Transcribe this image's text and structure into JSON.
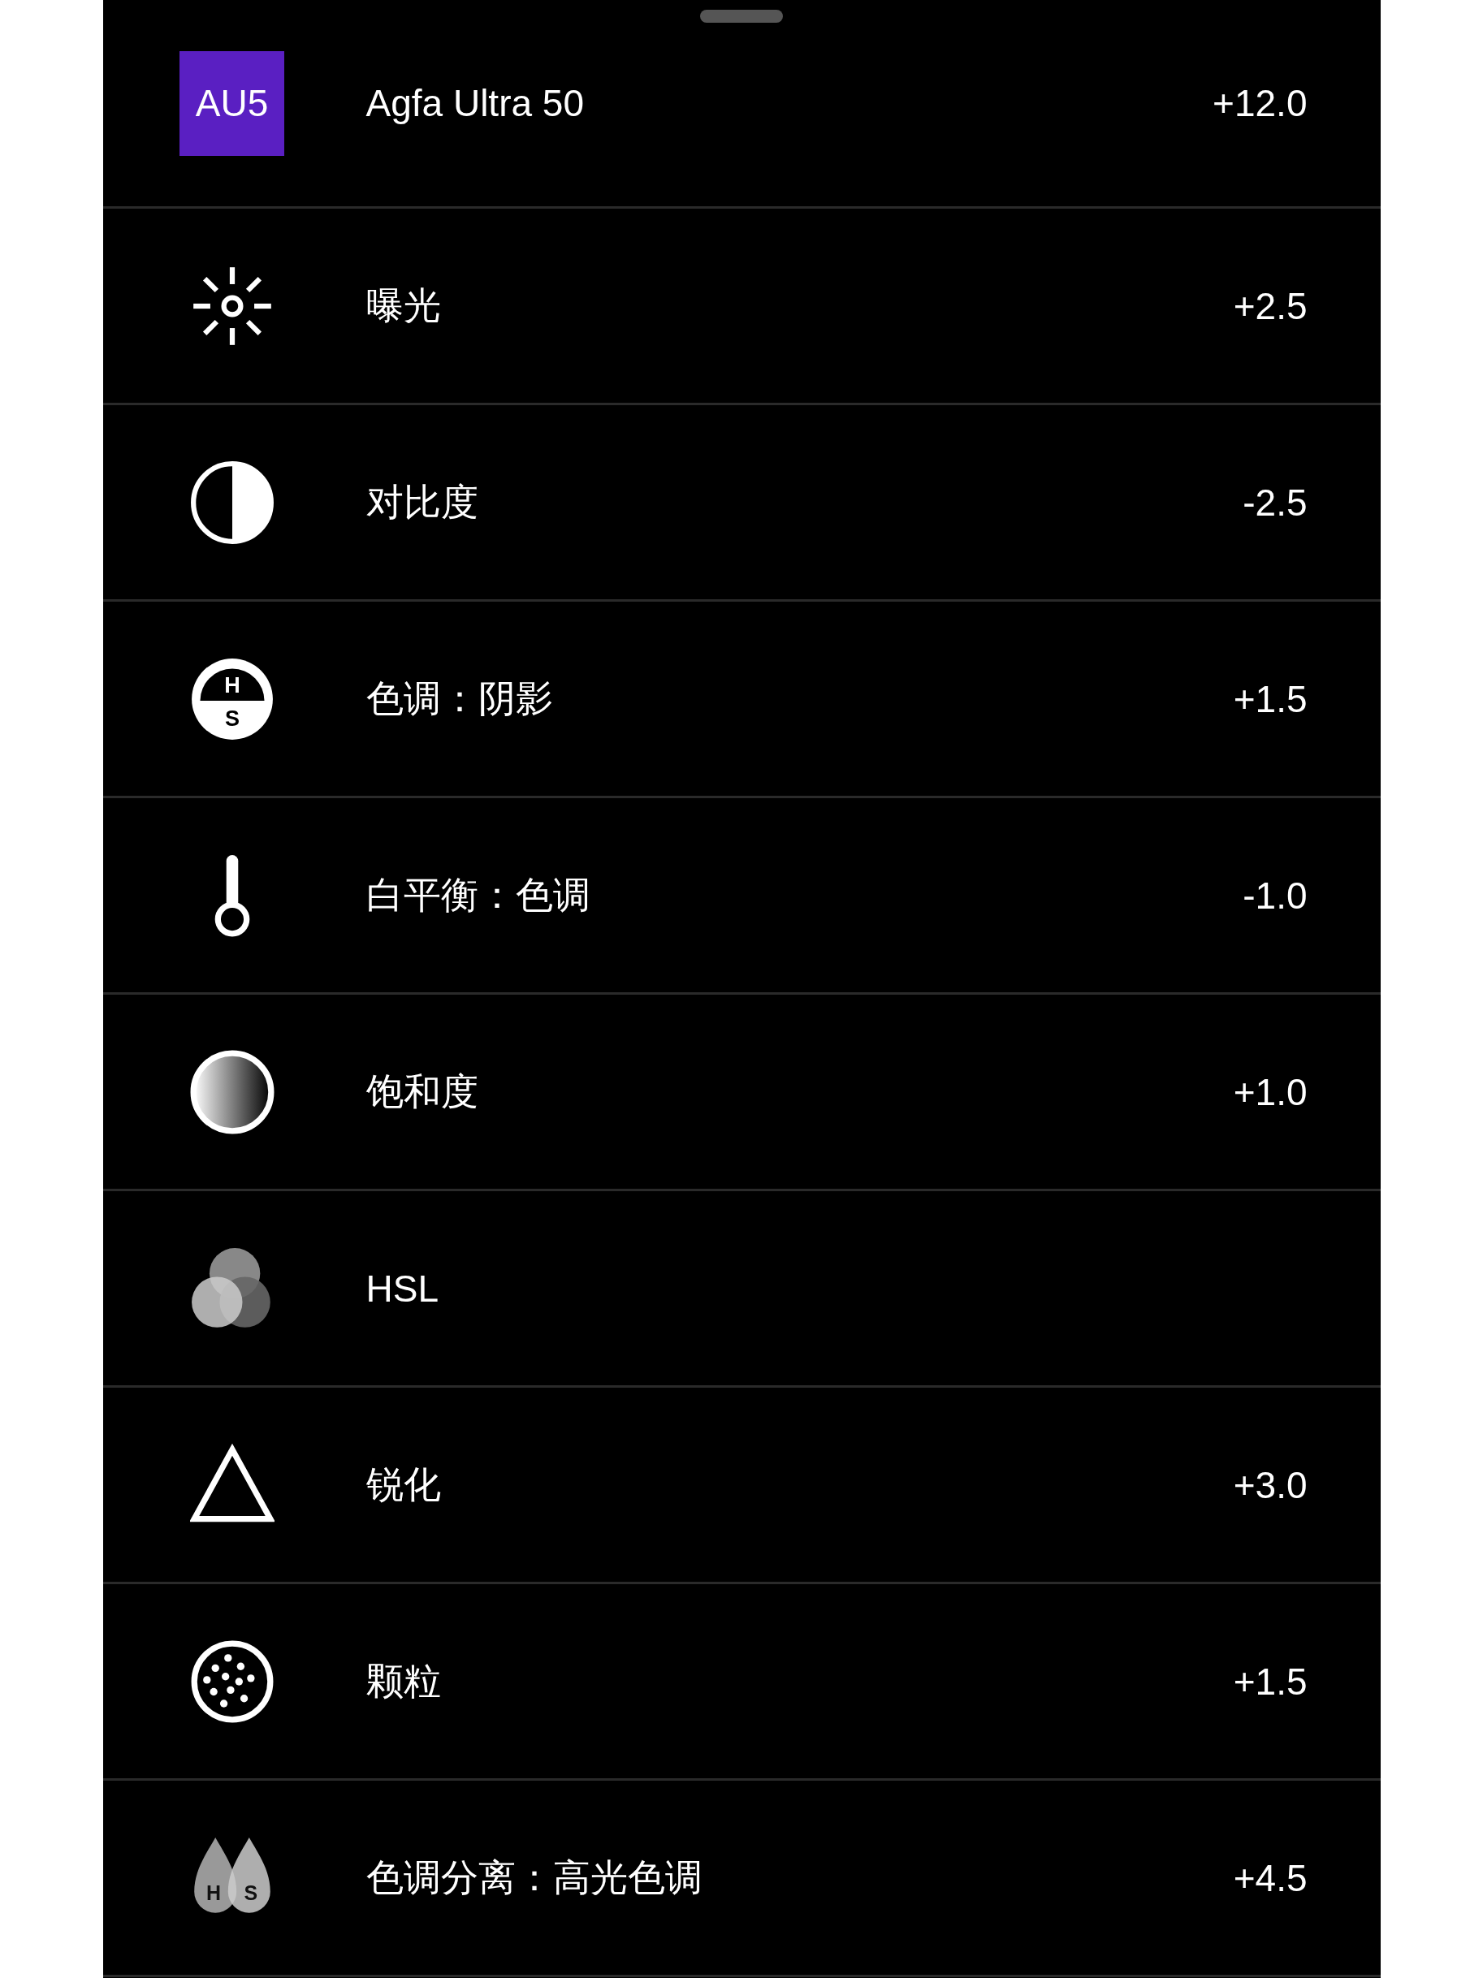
{
  "film": {
    "code": "AU5",
    "name": "Agfa Ultra 50",
    "value": "+12.0",
    "color": "#5a1fc2"
  },
  "adjustments": [
    {
      "kind": "sun",
      "label": "曝光",
      "value": "+2.5"
    },
    {
      "kind": "contrast",
      "label": "对比度",
      "value": "-2.5"
    },
    {
      "kind": "hs-circle",
      "letters": [
        "H",
        "S"
      ],
      "label": "色调：阴影",
      "value": "+1.5"
    },
    {
      "kind": "thermometer",
      "label": "白平衡：色调",
      "value": "-1.0"
    },
    {
      "kind": "saturation",
      "label": "饱和度",
      "value": "+1.0"
    },
    {
      "kind": "hsl",
      "label": "HSL"
    },
    {
      "kind": "triangle",
      "label": "锐化",
      "value": "+3.0"
    },
    {
      "kind": "grain",
      "label": "颗粒",
      "value": "+1.5"
    },
    {
      "kind": "hs-drops",
      "letters": [
        "H",
        "S"
      ],
      "label": "色调分离：高光色调",
      "value": "+4.5"
    }
  ]
}
